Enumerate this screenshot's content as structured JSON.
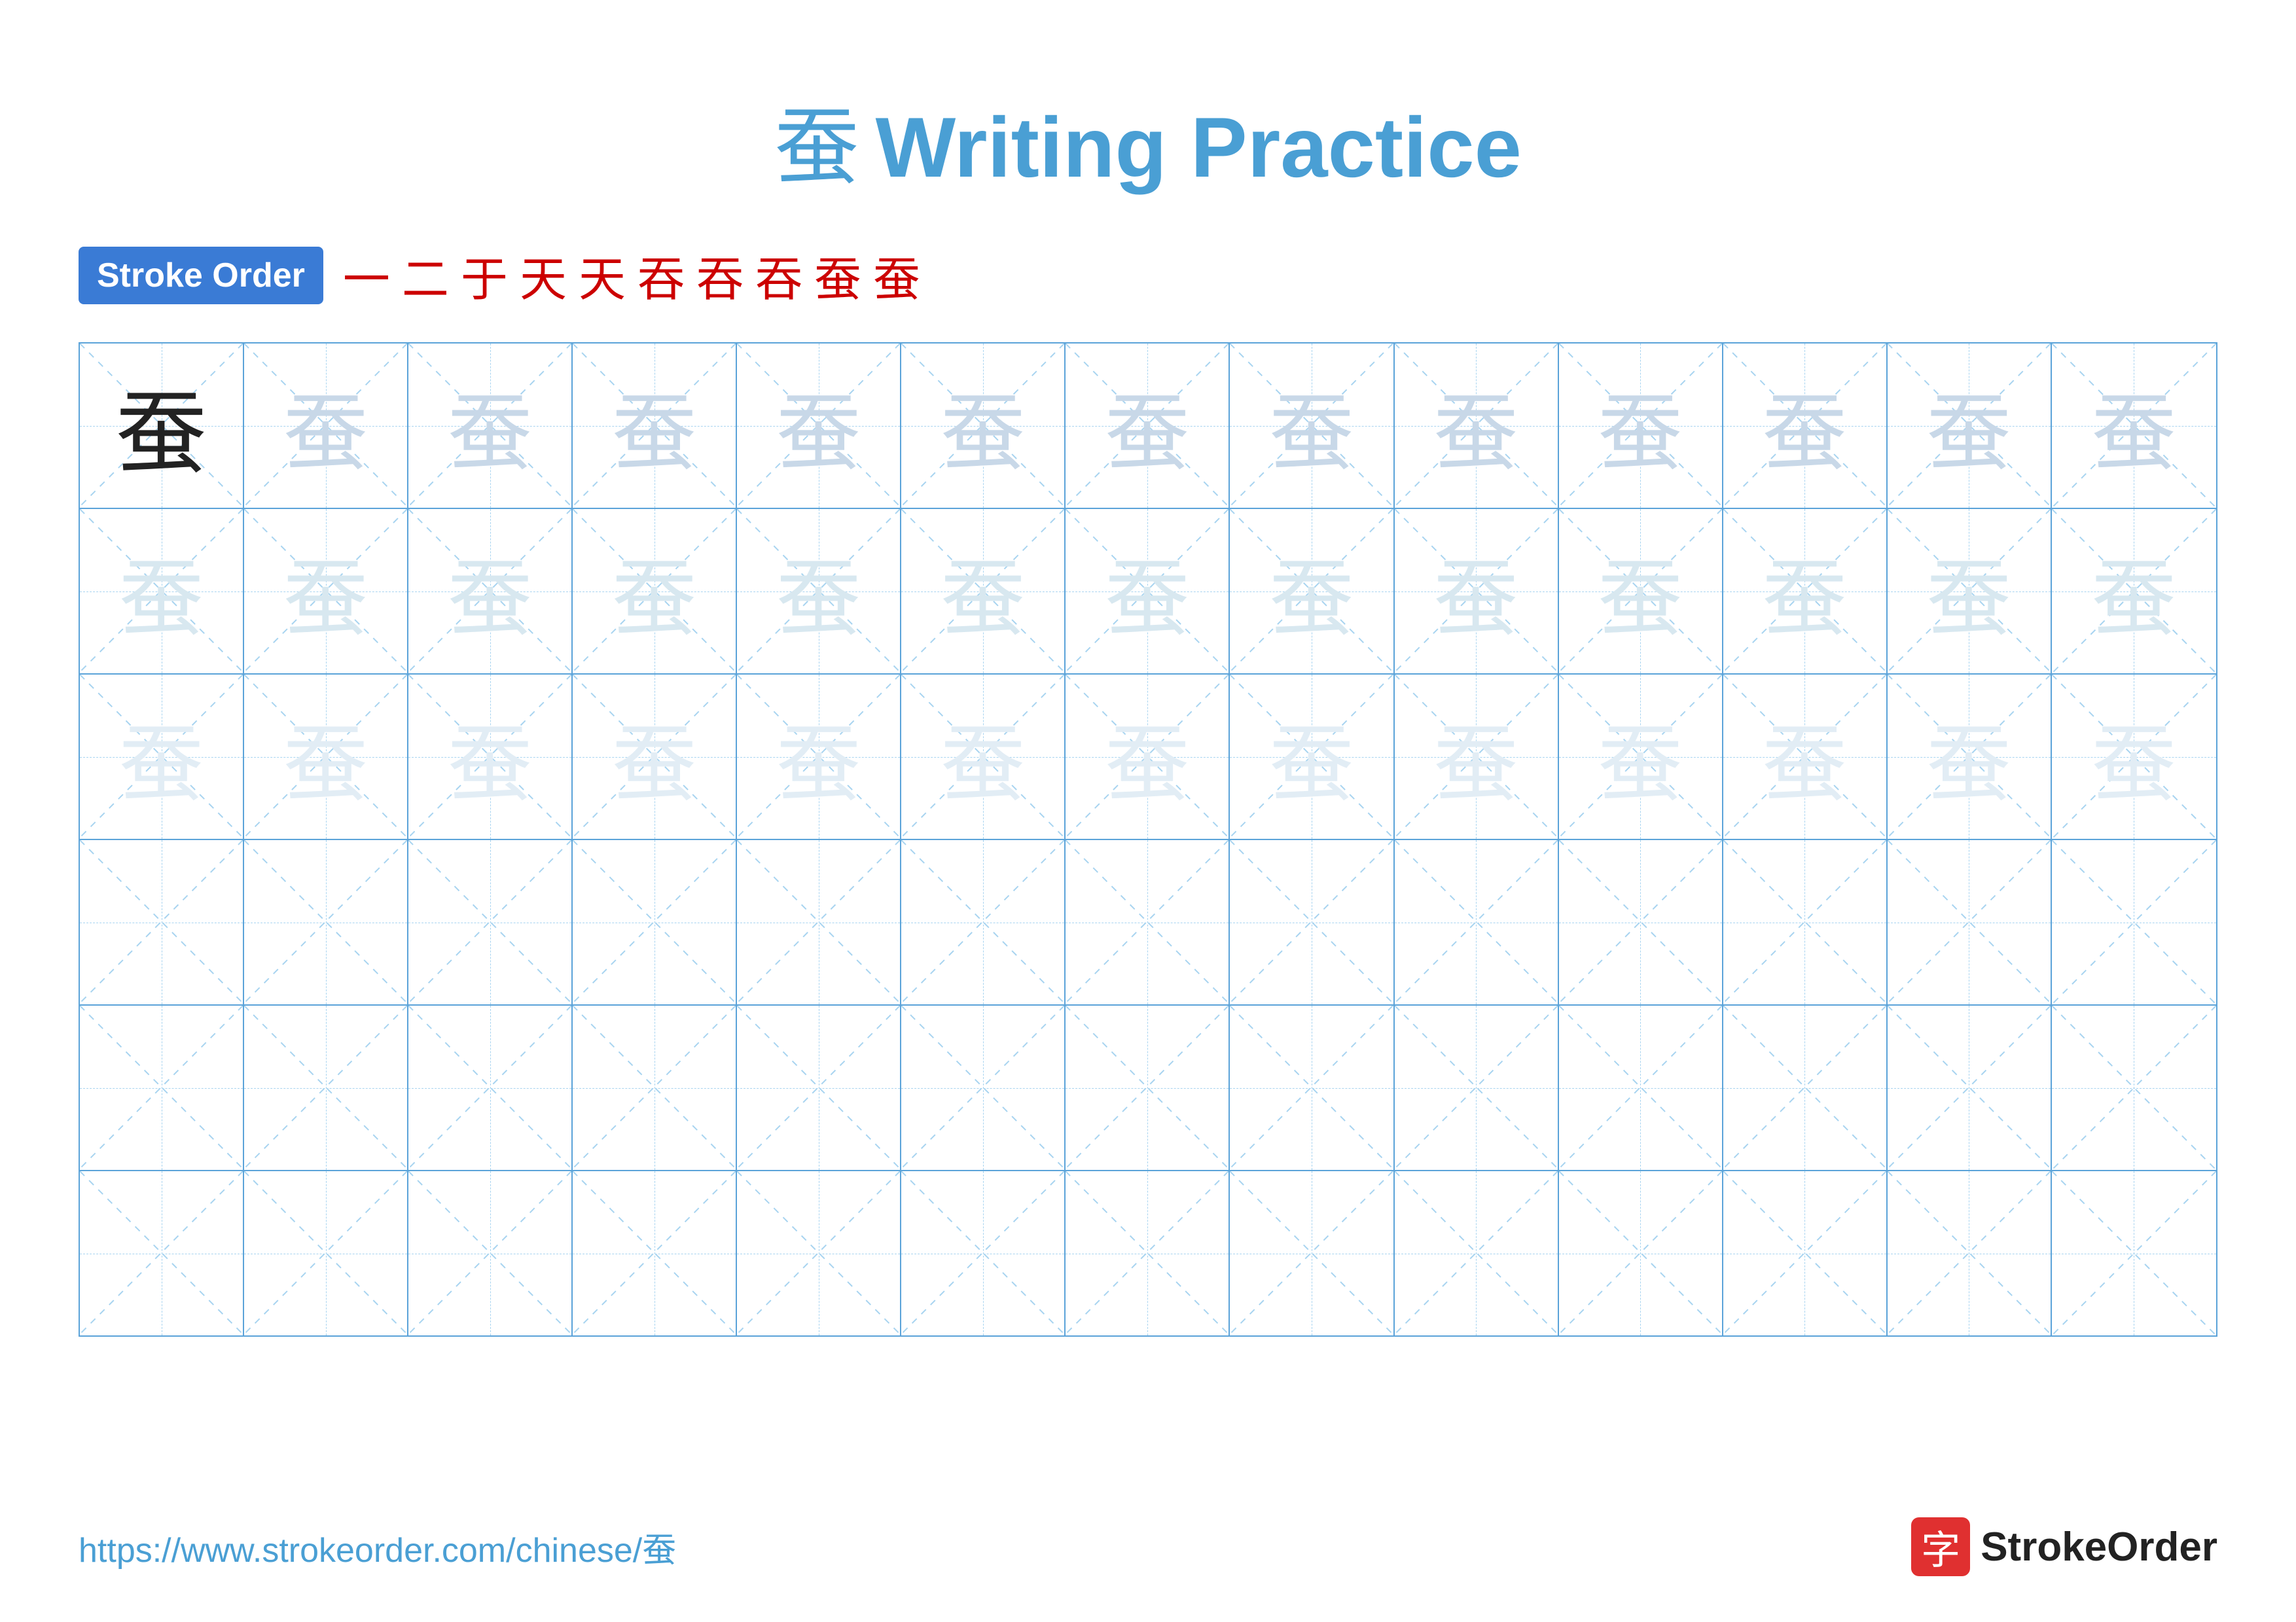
{
  "title": {
    "char": "蚕",
    "text": "Writing Practice"
  },
  "stroke_order": {
    "badge_label": "Stroke Order",
    "steps": [
      "一",
      "二",
      "于",
      "天",
      "天",
      "吞",
      "吞",
      "吞",
      "蚕",
      "蚕"
    ]
  },
  "grid": {
    "rows": 6,
    "cols": 13,
    "char": "蚕",
    "row1_opacity": "medium",
    "row2_opacity": "light",
    "row3_opacity": "lighter"
  },
  "footer": {
    "url": "https://www.strokeorder.com/chinese/蚕",
    "brand_char": "字",
    "brand_name": "StrokeOrder"
  }
}
